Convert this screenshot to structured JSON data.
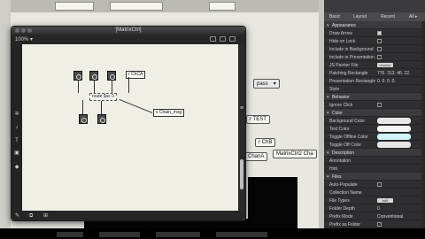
{
  "window": {
    "title": "[MatrixCtrl]",
    "zoom": "100%"
  },
  "patch_objects": {
    "prepend": "r ChCA",
    "route": "route $ss 0",
    "print_msg": "s Chain_msg"
  },
  "background_objects": {
    "pass": "pass",
    "test": "r TEST",
    "chb": "r ChB",
    "chana": "ChanA",
    "matrix": "MatrixCtrl2 Cha"
  },
  "inspector": {
    "tabs": [
      "Basic",
      "Layout",
      "Recent",
      "All"
    ],
    "rows": [
      {
        "kind": "section",
        "label": "Appearance"
      },
      {
        "kind": "check",
        "label": "Draw Arrow",
        "checked": true
      },
      {
        "kind": "check",
        "label": "Hide on Lock",
        "checked": false
      },
      {
        "kind": "check",
        "label": "Include in Background",
        "checked": false
      },
      {
        "kind": "check",
        "label": "Include in Presentation",
        "checked": false
      },
      {
        "kind": "chip",
        "label": "JS Painter File",
        "value": "choose"
      },
      {
        "kind": "text",
        "label": "Patching Rectangle",
        "value": "776. 313. 46. 22."
      },
      {
        "kind": "text",
        "label": "Presentation Rectangle",
        "value": "0. 0. 0. 0."
      },
      {
        "kind": "text",
        "label": "Style",
        "value": ""
      },
      {
        "kind": "section",
        "label": "Behavior"
      },
      {
        "kind": "check",
        "label": "Ignore Click",
        "checked": false
      },
      {
        "kind": "section",
        "label": "Color"
      },
      {
        "kind": "swatch",
        "label": "Background Color",
        "color": "#e8e8e8"
      },
      {
        "kind": "swatch",
        "label": "Text Color",
        "color": "#f4f4f4"
      },
      {
        "kind": "swatch",
        "label": "Toggle Offline Color",
        "color": "#d3f3fb"
      },
      {
        "kind": "swatch",
        "label": "Toggle Off Color",
        "color": "#e6e6e6"
      },
      {
        "kind": "section",
        "label": "Description"
      },
      {
        "kind": "text",
        "label": "Annotation",
        "value": ""
      },
      {
        "kind": "text",
        "label": "Hint",
        "value": ""
      },
      {
        "kind": "section",
        "label": "Files"
      },
      {
        "kind": "check",
        "label": "Auto-Populate",
        "checked": false
      },
      {
        "kind": "text",
        "label": "Collection Name",
        "value": ""
      },
      {
        "kind": "chip",
        "label": "File Types",
        "value": "edit"
      },
      {
        "kind": "text",
        "label": "Folder Depth",
        "value": "0"
      },
      {
        "kind": "text",
        "label": "Prefix Mode",
        "value": "Conventional"
      },
      {
        "kind": "check",
        "label": "Prefix as Folder",
        "checked": false
      }
    ]
  },
  "colors": {
    "inspector_bg": "#2f2f31",
    "canvas_bg": "#f0efe5",
    "toggle_offline": "#d3f3fb"
  }
}
